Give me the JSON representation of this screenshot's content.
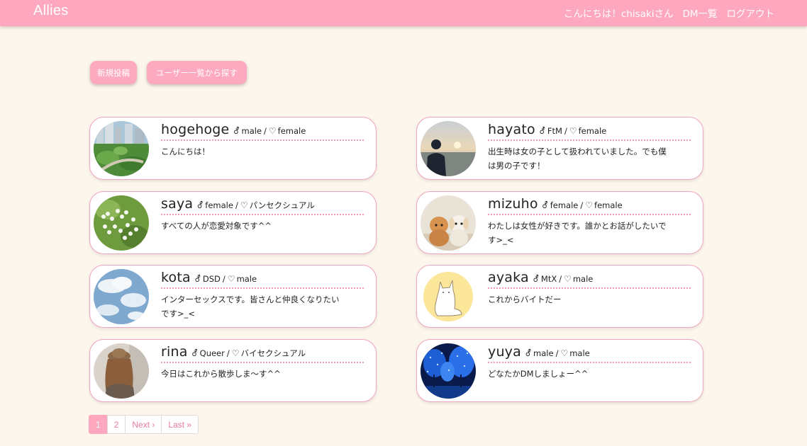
{
  "navbar": {
    "brand": "Allies",
    "greeting": "こんにちは！chisakiさん",
    "dm_list": "DM一覧",
    "logout": "ログアウト",
    "color": "#fda8be"
  },
  "actions": {
    "new_post": "新規投稿",
    "find_users": "ユーザー一覧から探す"
  },
  "separator": "/",
  "users": [
    {
      "name": "hogehoge",
      "gender": "male",
      "preference": "female",
      "bio": "こんにちは！",
      "avatar": "city-park-photo"
    },
    {
      "name": "hayato",
      "gender": "FtM",
      "preference": "female",
      "bio": "出生時は女の子として扱われていました。でも僕は男の子です！",
      "avatar": "sunset-silhouette-photo"
    },
    {
      "name": "saya",
      "gender": "female",
      "preference": "パンセクシュアル",
      "bio": "すべての人が恋愛対象です^^",
      "avatar": "white-flowers-photo"
    },
    {
      "name": "mizuho",
      "gender": "female",
      "preference": "female",
      "bio": "わたしは女性が好きです。誰かとお話がしたいです>_<",
      "avatar": "puppies-photo"
    },
    {
      "name": "kota",
      "gender": "DSD",
      "preference": "male",
      "bio": "インターセックスです。皆さんと仲良くなりたいです>_<",
      "avatar": "sky-clouds-photo"
    },
    {
      "name": "ayaka",
      "gender": "MtX",
      "preference": "male",
      "bio": "これからバイトだー",
      "avatar": "cat-illustration"
    },
    {
      "name": "rina",
      "gender": "Queer",
      "preference": "バイセクシュアル",
      "bio": "今日はこれから散歩しま〜す^^",
      "avatar": "woman-hat-photo"
    },
    {
      "name": "yuya",
      "gender": "male",
      "preference": "male",
      "bio": "どなたかDMしましょー^^",
      "avatar": "blue-illumination-photo"
    }
  ],
  "pagination": {
    "pages": [
      "1",
      "2"
    ],
    "current": "1",
    "next": "Next ›",
    "last": "Last »"
  },
  "colors": {
    "background": "#fdf6ec",
    "accent": "#fda8be",
    "card_border": "#f0a6c2"
  }
}
